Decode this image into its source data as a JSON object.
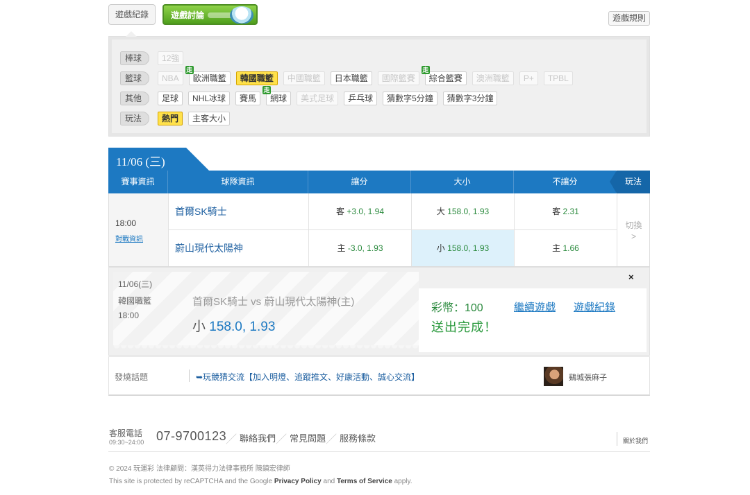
{
  "tabs": {
    "records": "遊戲紀錄",
    "discuss": "遊戲討論",
    "rules": "遊戲規則"
  },
  "filters": [
    {
      "category": "棒球",
      "items": [
        {
          "label": "12強",
          "state": "disabled"
        }
      ]
    },
    {
      "category": "籃球",
      "items": [
        {
          "label": "NBA",
          "state": "disabled"
        },
        {
          "label": "歐洲職籃",
          "state": "normal",
          "badge": "走"
        },
        {
          "label": "韓國職籃",
          "state": "active"
        },
        {
          "label": "中國職籃",
          "state": "disabled"
        },
        {
          "label": "日本職籃",
          "state": "normal"
        },
        {
          "label": "國際籃賽",
          "state": "disabled"
        },
        {
          "label": "綜合籃賽",
          "state": "normal",
          "badge": "走"
        },
        {
          "label": "澳洲職籃",
          "state": "disabled"
        },
        {
          "label": "P+",
          "state": "disabled"
        },
        {
          "label": "TPBL",
          "state": "disabled"
        }
      ]
    },
    {
      "category": "其他",
      "items": [
        {
          "label": "足球",
          "state": "normal"
        },
        {
          "label": "NHL冰球",
          "state": "normal"
        },
        {
          "label": "賽馬",
          "state": "normal"
        },
        {
          "label": "網球",
          "state": "normal",
          "badge": "走"
        },
        {
          "label": "美式足球",
          "state": "disabled"
        },
        {
          "label": "乒乓球",
          "state": "normal"
        },
        {
          "label": "猜數字5分鐘",
          "state": "normal"
        },
        {
          "label": "猜數字3分鐘",
          "state": "normal"
        }
      ]
    },
    {
      "category": "玩法",
      "items": [
        {
          "label": "熱門",
          "state": "active"
        },
        {
          "label": "主客大小",
          "state": "normal"
        }
      ]
    }
  ],
  "date_tab": "11/06 (三)",
  "table": {
    "headers": [
      "賽事資訊",
      "球隊資訊",
      "讓分",
      "大小",
      "不讓分",
      "玩法"
    ],
    "time": "18:00",
    "info_link": "對戰資訊",
    "switch": "切換",
    "switch_arrow": ">",
    "rows": [
      {
        "team": "首爾SK騎士",
        "spread_prefix": "客",
        "spread_value": "+3.0, 1.94",
        "total_prefix": "大",
        "total_value": "158.0, 1.93",
        "ml_prefix": "客",
        "ml_value": "2.31"
      },
      {
        "team": "蔚山現代太陽神",
        "spread_prefix": "主",
        "spread_value": "-3.0, 1.93",
        "total_prefix": "小",
        "total_value": "158.0, 1.93",
        "ml_prefix": "主",
        "ml_value": "1.66"
      }
    ]
  },
  "confirm": {
    "date": "11/06(三)",
    "league": "韓國職籃",
    "time": "18:00",
    "match": "首爾SK騎士  vs  蔚山現代太陽神(主)",
    "pick_prefix": "小",
    "pick_value": "158.0, 1.93",
    "coins": "彩幣：100",
    "done": "送出完成！",
    "continue_link": "繼續遊戲",
    "records_link": "遊戲紀錄",
    "close": "×"
  },
  "topic": {
    "label": "發燒話題",
    "text": "➥玩競猜交流【加入明燈、追蹤推文、好康活動、誠心交流】",
    "user": "鷄城張麻子"
  },
  "footer": {
    "service_label": "客服電話",
    "hours": "09:30~24:00",
    "phone": "07-9700123",
    "slash": "／",
    "links": [
      "聯絡我們",
      "常見問題",
      "服務條款"
    ],
    "about": "關於我們",
    "copyright": "© 2024 玩運彩 法律顧問：漢英得力法律事務所 陳鎮宏律師",
    "recaptcha_pre": "This site is protected by reCAPTCHA and the Google",
    "privacy": "Privacy Policy",
    "and": "and",
    "terms": "Terms of Service",
    "apply": "apply."
  }
}
